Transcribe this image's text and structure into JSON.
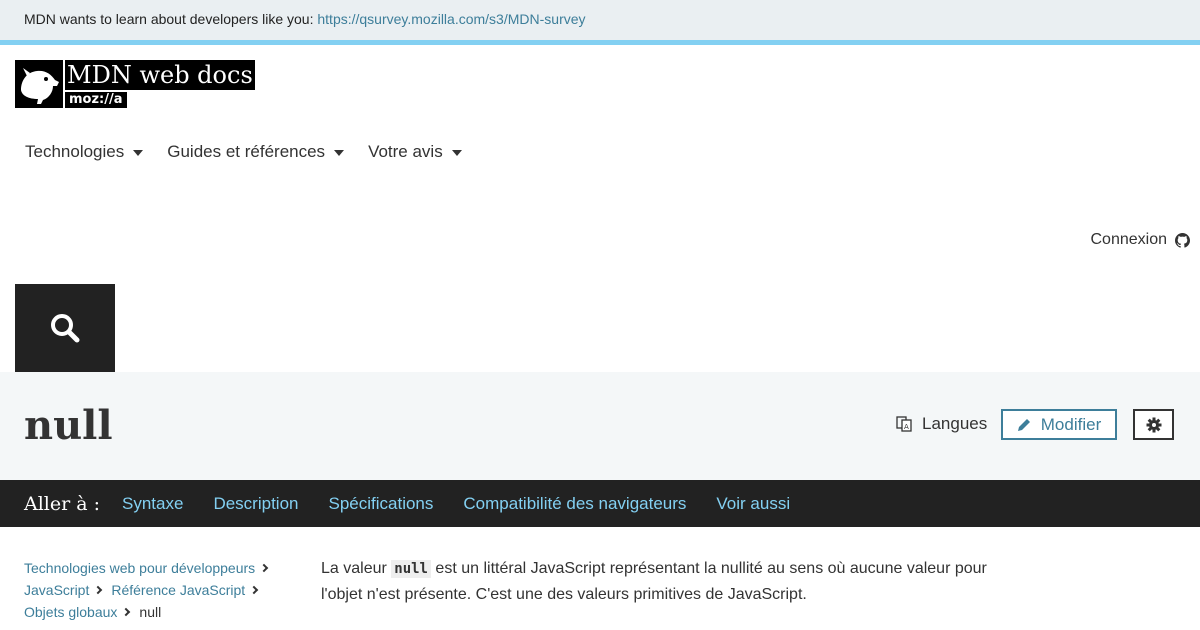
{
  "banner": {
    "message": "MDN wants to learn about developers like you: ",
    "link": "https://qsurvey.mozilla.com/s3/MDN-survey"
  },
  "logo": {
    "title": "MDN web docs",
    "org": "moz://a"
  },
  "nav": {
    "items": [
      {
        "label": "Technologies"
      },
      {
        "label": "Guides et références"
      },
      {
        "label": "Votre avis"
      }
    ],
    "login": "Connexion"
  },
  "page": {
    "title": "null",
    "languages_label": "Langues",
    "edit_label": "Modifier"
  },
  "jump": {
    "label": "Aller à :",
    "links": [
      "Syntaxe",
      "Description",
      "Spécifications",
      "Compatibilité des navigateurs",
      "Voir aussi"
    ]
  },
  "breadcrumbs": {
    "items": [
      "Technologies web pour développeurs",
      "JavaScript",
      "Référence JavaScript",
      "Objets globaux"
    ],
    "current": "null"
  },
  "content": {
    "p1_before": "La valeur ",
    "p1_code": "null",
    "p1_after": " est un littéral JavaScript représentant la nullité au sens où aucune valeur pour l'objet n'est présente. C'est une des valeurs primitives de JavaScript."
  },
  "colors": {
    "link": "#3d7e9a",
    "accent_bar": "#83d0f2",
    "dark": "#222222",
    "title_bg": "#f4f7f8"
  }
}
